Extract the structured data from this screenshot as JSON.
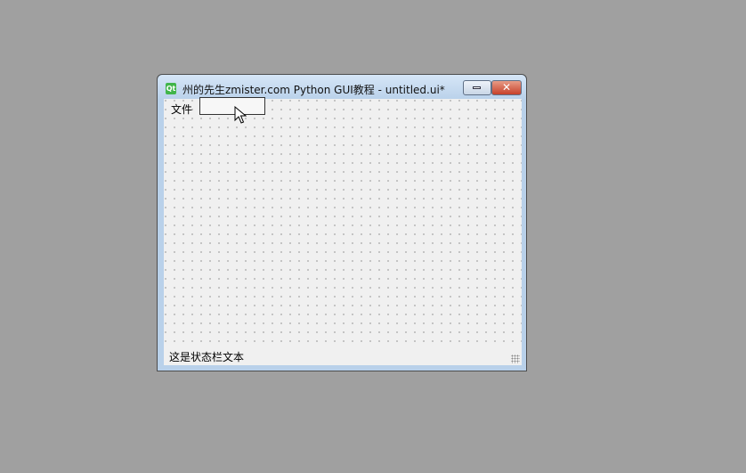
{
  "window": {
    "title": "州的先生zmister.com Python GUI教程 - untitled.ui*",
    "app_icon_text": "Qt",
    "icon": "qt-icon"
  },
  "title_buttons": {
    "minimize_icon": "minimize-icon",
    "close_icon": "close-icon",
    "close_glyph": "✕"
  },
  "menubar": {
    "items": [
      {
        "label": "文件"
      }
    ],
    "new_item_placeholder": ""
  },
  "statusbar": {
    "text": "这是状态栏文本"
  },
  "colors": {
    "desktop": "#a0a0a0",
    "title_bar": "#b9d1ea",
    "close_button": "#c7412a",
    "client_background": "#f0f0f0"
  }
}
